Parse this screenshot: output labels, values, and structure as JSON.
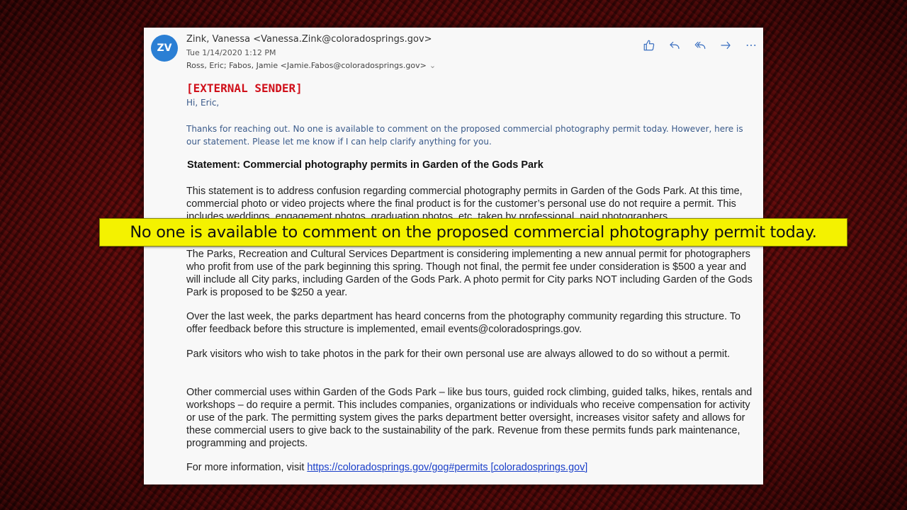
{
  "email": {
    "avatar_initials": "ZV",
    "from": "Zink, Vanessa <Vanessa.Zink@coloradosprings.gov>",
    "date": "Tue 1/14/2020 1:12 PM",
    "to": "Ross, Eric; Fabos, Jamie <Jamie.Fabos@coloradosprings.gov>",
    "external_sender": "[EXTERNAL SENDER]",
    "greeting": "Hi, Eric,",
    "intro": "Thanks for reaching out. No one is available to comment on the proposed commercial photography permit today. However, here is our statement.  Please let me know if I can help clarify anything for you.",
    "statement_title": "Statement: Commercial photography permits in Garden of the Gods Park",
    "paragraphs": {
      "p1": "This statement is to address confusion regarding commercial photography permits in Garden of the Gods Park. At this time, commercial photo or video projects where the final product is for the customer’s personal use do not require a permit. This includes weddings, engagement photos, graduation photos, etc. taken by professional, paid photographers.",
      "p2": "The Parks, Recreation and Cultural Services Department is considering implementing a new annual permit for photographers who profit from use of the park beginning this spring. Though not final, the permit fee under consideration is $500 a year and will include all City parks, including Garden of the Gods Park. A photo permit for City parks NOT including Garden of the Gods Park is proposed to be $250 a year.",
      "p3": "Over the last week, the parks department has heard concerns from the photography community regarding this structure. To offer feedback before this structure is implemented, email events@coloradosprings.gov.",
      "p4": "Park visitors who wish to take photos in the park for their own personal use are always allowed to do so without a permit.",
      "p5": "Other commercial uses within Garden of the Gods Park – like bus tours, guided rock climbing, guided talks, hikes, rentals and workshops – do require a permit. This includes companies, organizations or individuals who receive compensation for activity or use of the park. The permitting system gives the parks department better oversight, increases visitor safety and allows for these commercial users to give back to the sustainability of the park. Revenue from these permits funds park maintenance, programming and projects.",
      "p6_prefix": "For more information, visit ",
      "p6_link": "https://coloradosprings.gov/gog#permits [coloradosprings.gov]"
    },
    "actions": [
      "like-icon",
      "reply-icon",
      "reply-all-icon",
      "forward-icon",
      "more-icon"
    ]
  },
  "caption": {
    "text": "No one is available to comment on the proposed commercial photography permit today."
  },
  "colors": {
    "avatar_bg": "#2b7fd4",
    "external_sender": "#d0101a",
    "action_icons": "#3a6fc0",
    "caption_bg": "#f4f200",
    "link": "#1a3fc9"
  }
}
